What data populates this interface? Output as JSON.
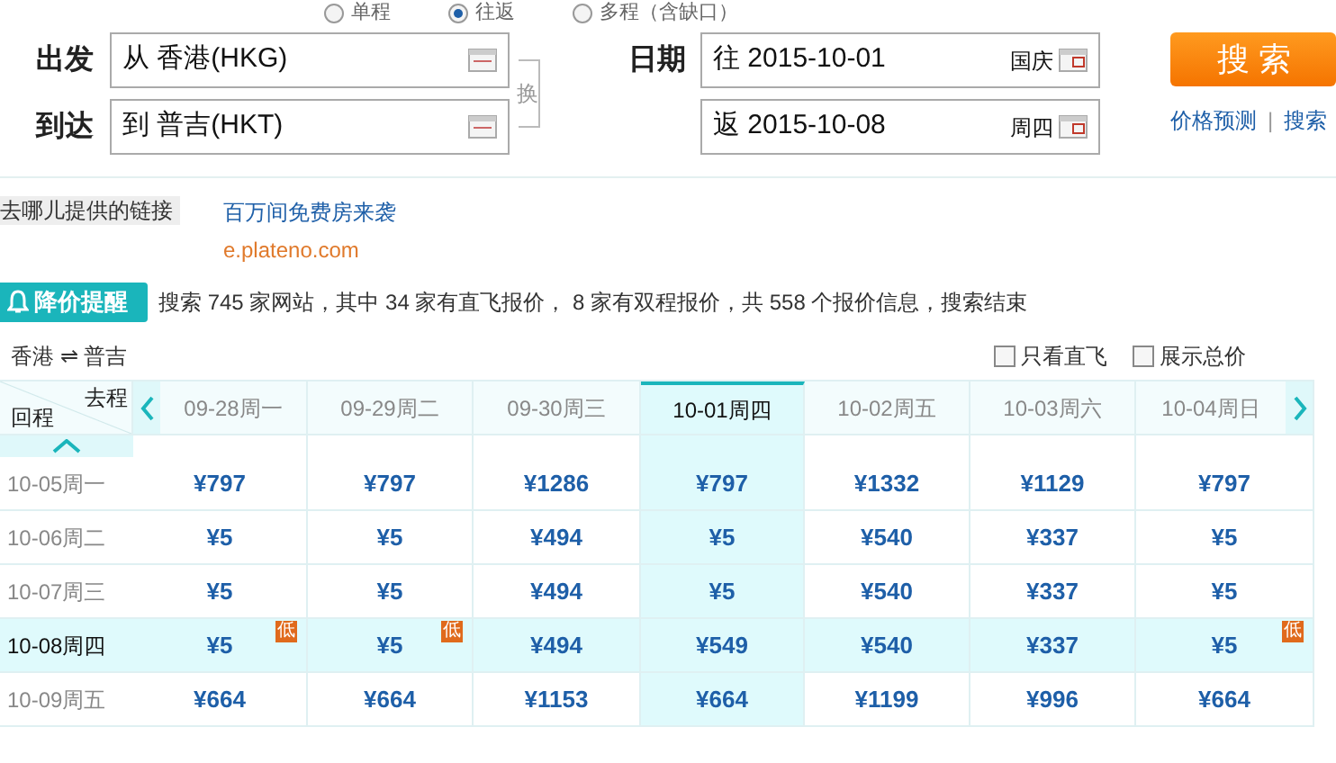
{
  "trip_types": [
    {
      "label": "单程",
      "selected": false
    },
    {
      "label": "往返",
      "selected": true
    },
    {
      "label": "多程（含缺口）",
      "selected": false
    }
  ],
  "form": {
    "from_label": "出发",
    "from_value": "从 香港(HKG)",
    "to_label": "到达",
    "to_value": "到 普吉(HKT)",
    "swap": "换",
    "date_label": "日期",
    "depart": {
      "value": "往 2015-10-01",
      "note": "国庆"
    },
    "return": {
      "value": "返 2015-10-08",
      "note": "周四"
    },
    "search_button": "搜 索",
    "links": [
      "价格预测",
      "搜索"
    ],
    "link_separator": "|"
  },
  "ad": {
    "source": "去哪儿提供的链接",
    "title": "百万间免费房来袭",
    "url": "e.plateno.com"
  },
  "alert": {
    "badge": "降价提醒",
    "message": "搜索 745 家网站，其中 34 家有直飞报价， 8 家有双程报价，共 558 个报价信息，搜索结束"
  },
  "route": "香港 ⇌ 普吉",
  "filters": [
    {
      "label": "只看直飞",
      "checked": false
    },
    {
      "label": "展示总价",
      "checked": false
    }
  ],
  "table": {
    "corner_depart": "去程",
    "corner_return": "回程",
    "columns": [
      {
        "label": "09-28周一",
        "selected": false
      },
      {
        "label": "09-29周二",
        "selected": false
      },
      {
        "label": "09-30周三",
        "selected": false
      },
      {
        "label": "10-01周四",
        "selected": true
      },
      {
        "label": "10-02周五",
        "selected": false
      },
      {
        "label": "10-03周六",
        "selected": false
      },
      {
        "label": "10-04周日",
        "selected": false
      }
    ],
    "rows": [
      {
        "label": "10-05周一",
        "selected": false,
        "cells": [
          {
            "price": "¥797"
          },
          {
            "price": "¥797"
          },
          {
            "price": "¥1286"
          },
          {
            "price": "¥797"
          },
          {
            "price": "¥1332"
          },
          {
            "price": "¥1129"
          },
          {
            "price": "¥797"
          }
        ]
      },
      {
        "label": "10-06周二",
        "selected": false,
        "cells": [
          {
            "price": "¥5"
          },
          {
            "price": "¥5"
          },
          {
            "price": "¥494"
          },
          {
            "price": "¥5"
          },
          {
            "price": "¥540"
          },
          {
            "price": "¥337"
          },
          {
            "price": "¥5"
          }
        ]
      },
      {
        "label": "10-07周三",
        "selected": false,
        "cells": [
          {
            "price": "¥5"
          },
          {
            "price": "¥5"
          },
          {
            "price": "¥494"
          },
          {
            "price": "¥5"
          },
          {
            "price": "¥540"
          },
          {
            "price": "¥337"
          },
          {
            "price": "¥5"
          }
        ]
      },
      {
        "label": "10-08周四",
        "selected": true,
        "cells": [
          {
            "price": "¥5",
            "badge": "低"
          },
          {
            "price": "¥5",
            "badge": "低"
          },
          {
            "price": "¥494"
          },
          {
            "price": "¥549"
          },
          {
            "price": "¥540"
          },
          {
            "price": "¥337"
          },
          {
            "price": "¥5",
            "badge": "低"
          }
        ]
      },
      {
        "label": "10-09周五",
        "selected": false,
        "cells": [
          {
            "price": "¥664"
          },
          {
            "price": "¥664"
          },
          {
            "price": "¥1153"
          },
          {
            "price": "¥664"
          },
          {
            "price": "¥1199"
          },
          {
            "price": "¥996"
          },
          {
            "price": "¥664"
          }
        ]
      }
    ]
  }
}
